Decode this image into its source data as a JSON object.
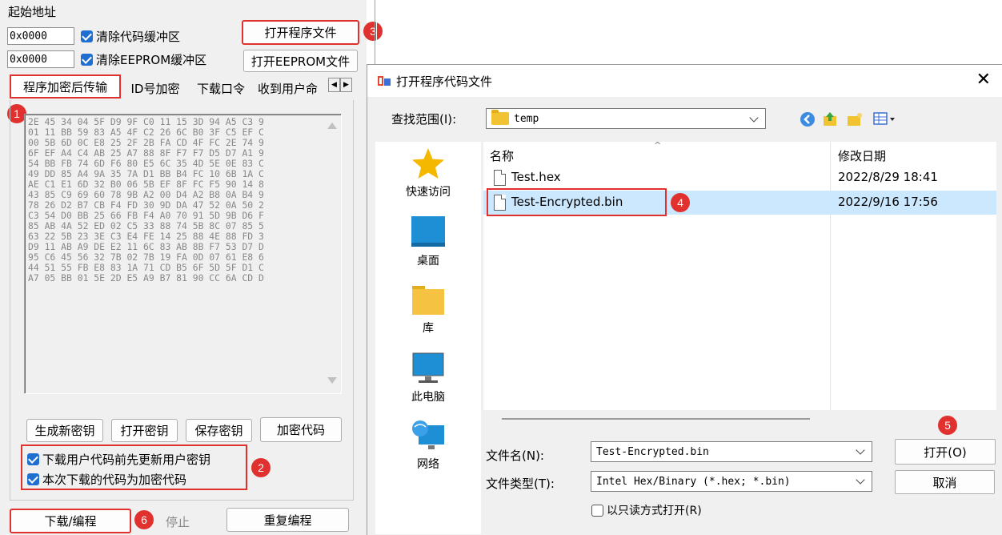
{
  "left_panel": {
    "start_address_label": "起始地址",
    "code_address": "0x0000",
    "eeprom_address": "0x0000",
    "clear_code_buffer": "清除代码缓冲区",
    "clear_eeprom_buffer": "清除EEPROM缓冲区",
    "open_program_file": "打开程序文件",
    "open_eeprom_file": "打开EEPROM文件",
    "tabs": [
      "程序加密后传输",
      "ID号加密",
      "下载口令",
      "收到用户命"
    ],
    "hex_lines": [
      "2E 45 34 04 5F D9 9F C0 11 15 3D 94 A5 C3 9",
      "01 11 BB 59 83 A5 4F C2 26 6C B0 3F C5 EF C",
      "00 5B 6D 0C E8 25 2F 2B FA CD 4F FC 2E 74 9",
      "6F EF A4 C4 AB 25 A7 88 8F F7 F7 D5 D7 A1 9",
      "54 BB FB 74 6D F6 80 E5 6C 35 4D 5E 0E 83 C",
      "49 DD 85 A4 9A 35 7A D1 BB B4 FC 10 6B 1A C",
      "AE C1 E1 6D 32 B0 06 5B EF 8F FC F5 90 14 8",
      "43 85 C9 69 60 78 9B A2 00 D4 A2 B8 0A B4 9",
      "78 26 D2 B7 CB F4 FD 30 9D DA 47 52 0A 50 2",
      "C3 54 D0 BB 25 66 FB F4 A0 70 91 5D 9B D6 F",
      "85 AB 4A 52 ED 02 C5 33 88 74 5B 8C 07 85 5",
      "63 22 5B 23 3E C3 E4 FE 14 25 88 4E 88 FD 3",
      "D9 11 AB A9 DE E2 11 6C 83 AB 8B F7 53 D7 D",
      "95 C6 45 56 32 7B 02 7B 19 FA 0D 07 61 E8 6",
      "44 51 55 FB E8 83 1A 71 CD B5 6F 5D 5F D1 C",
      "A7 05 BB 01 5E 2D E5 A9 B7 81 90 CC 6A CD D"
    ],
    "key_buttons": [
      "生成新密钥",
      "打开密钥",
      "保存密钥",
      "加密代码"
    ],
    "update_key_option": "下载用户代码前先更新用户密钥",
    "encrypted_code_option": "本次下载的代码为加密代码",
    "download_button": "下载/编程",
    "stop_button": "停止",
    "reprogram_button": "重复编程"
  },
  "markers": [
    "1",
    "2",
    "3",
    "4",
    "5",
    "6"
  ],
  "dialog": {
    "title": "打开程序代码文件",
    "look_in_label": "查找范围(I):",
    "look_in_value": "temp",
    "places": [
      "快速访问",
      "桌面",
      "库",
      "此电脑",
      "网络"
    ],
    "columns": {
      "name": "名称",
      "modified": "修改日期"
    },
    "files": [
      {
        "name": "Test.hex",
        "modified": "2022/8/29 18:41"
      },
      {
        "name": "Test-Encrypted.bin",
        "modified": "2022/9/16 17:56"
      }
    ],
    "filename_label": "文件名(N):",
    "filename_value": "Test-Encrypted.bin",
    "filetype_label": "文件类型(T):",
    "filetype_value": "Intel Hex/Binary (*.hex; *.bin)",
    "readonly_label": "以只读方式打开(R)",
    "open_button": "打开(O)",
    "cancel_button": "取消",
    "close_symbol": "✕"
  },
  "colors": {
    "marker_red": "#e0312f",
    "checkbox_blue": "#1f6fd0",
    "selection": "#cce8ff"
  }
}
